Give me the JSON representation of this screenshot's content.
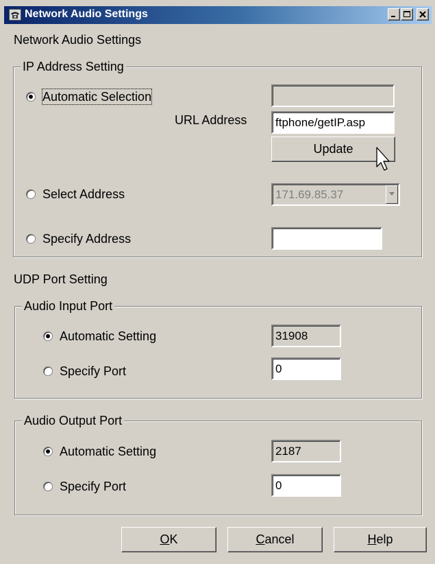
{
  "window": {
    "title": "Network Audio Settings",
    "icon": "phone-icon",
    "controls": [
      "minimize",
      "maximize",
      "close"
    ]
  },
  "heading": "Network Audio Settings",
  "ip_group": {
    "legend": "IP Address Setting",
    "automatic": {
      "label": "Automatic Selection",
      "selected": true,
      "display_value": ""
    },
    "url_label": "URL Address",
    "url_value": "ftphone/getIP.asp",
    "update_button": "Update",
    "select": {
      "label": "Select Address",
      "selected": false,
      "value": "171.69.85.37"
    },
    "specify": {
      "label": "Specify Address",
      "selected": false,
      "value": ""
    }
  },
  "udp_heading": "UDP Port Setting",
  "audio_input": {
    "legend": "Audio Input Port",
    "automatic": {
      "label": "Automatic Setting",
      "selected": true,
      "value": "31908"
    },
    "specify": {
      "label": "Specify Port",
      "selected": false,
      "value": "0"
    }
  },
  "audio_output": {
    "legend": "Audio Output Port",
    "automatic": {
      "label": "Automatic Setting",
      "selected": true,
      "value": "2187"
    },
    "specify": {
      "label": "Specify Port",
      "selected": false,
      "value": "0"
    }
  },
  "buttons": {
    "ok": {
      "label": "OK",
      "mnemonic": "O",
      "rest": "K"
    },
    "cancel": {
      "label": "Cancel",
      "mnemonic": "C",
      "rest": "ancel"
    },
    "help": {
      "label": "Help",
      "mnemonic": "H",
      "rest": "elp"
    }
  },
  "colors": {
    "titlebar_start": "#0a246a",
    "titlebar_end": "#a6caf0",
    "face": "#d4d0c8"
  }
}
